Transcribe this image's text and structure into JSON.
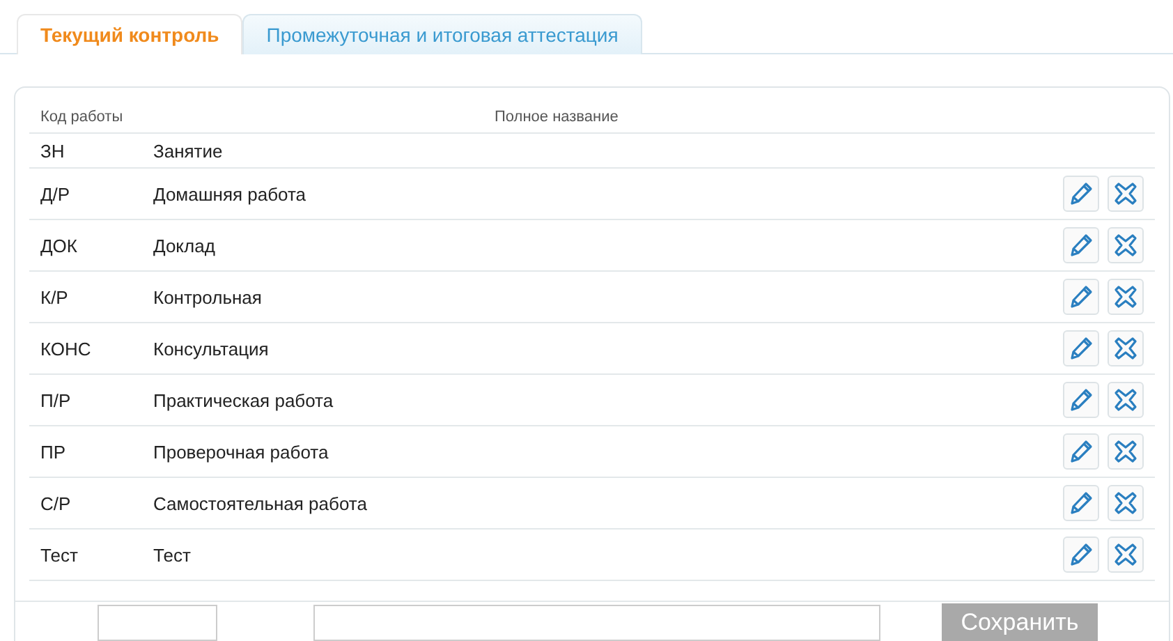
{
  "tabs": [
    {
      "label": "Текущий контроль",
      "selected": true
    },
    {
      "label": "Промежуточная и итоговая аттестация",
      "selected": false
    }
  ],
  "table": {
    "columns": [
      "Код работы",
      "Полное название"
    ],
    "rows": [
      {
        "code": "ЗН",
        "name": "Занятие",
        "editable": false
      },
      {
        "code": "Д/Р",
        "name": "Домашняя работа",
        "editable": true
      },
      {
        "code": "ДОК",
        "name": "Доклад",
        "editable": true
      },
      {
        "code": "К/Р",
        "name": "Контрольная",
        "editable": true
      },
      {
        "code": "КОНС",
        "name": "Консультация",
        "editable": true
      },
      {
        "code": "П/Р",
        "name": "Практическая работа",
        "editable": true
      },
      {
        "code": "ПР",
        "name": "Проверочная работа",
        "editable": true
      },
      {
        "code": "С/Р",
        "name": "Самостоятельная работа",
        "editable": true
      },
      {
        "code": "Тест",
        "name": "Тест",
        "editable": true
      }
    ]
  },
  "form": {
    "save_button": {
      "label": "Сохранить",
      "disabled": true
    }
  }
}
